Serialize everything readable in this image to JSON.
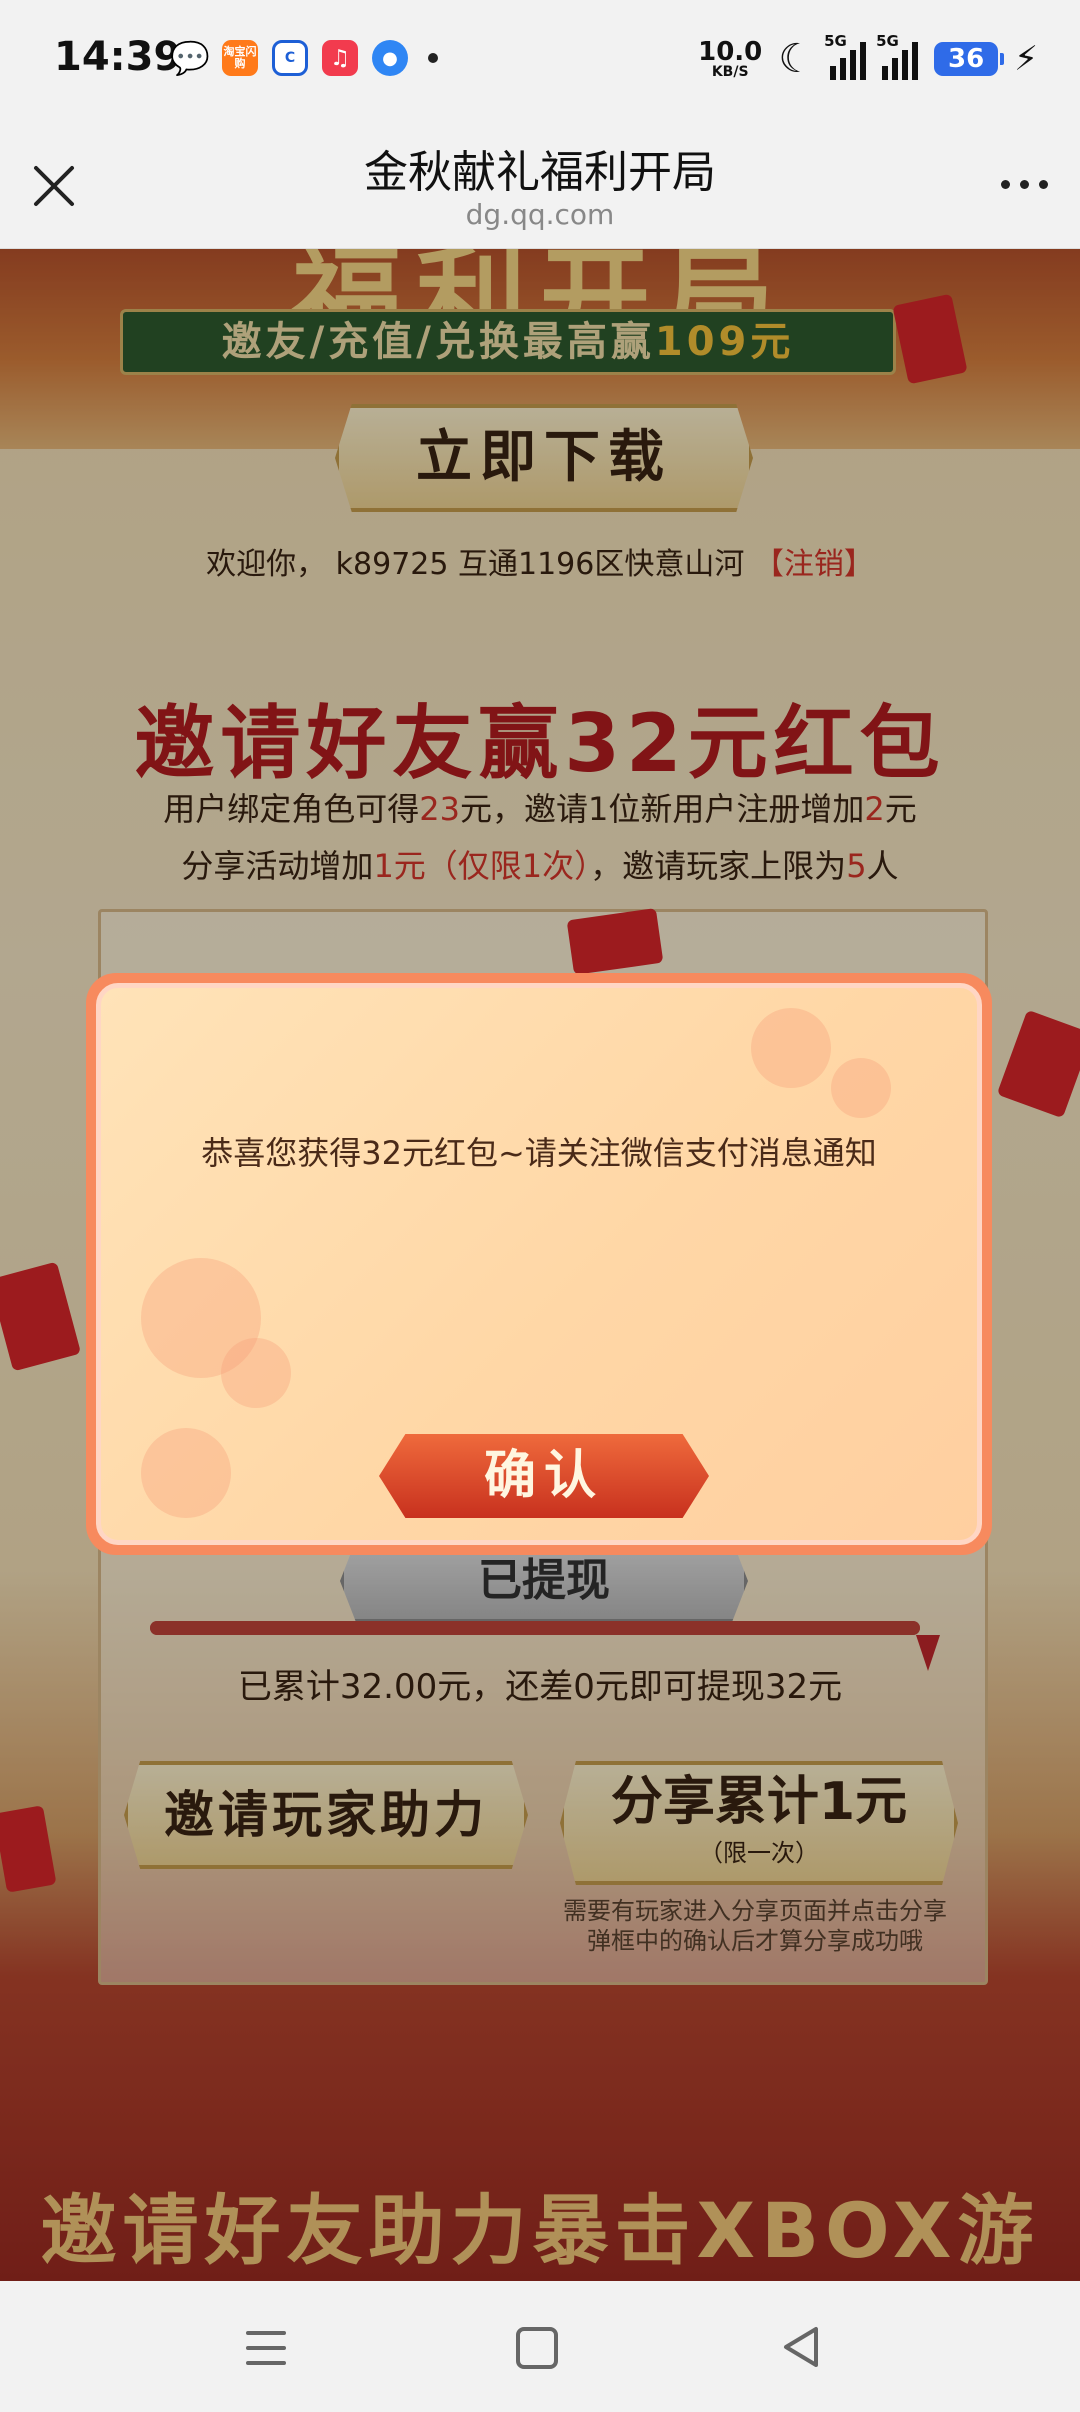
{
  "status_bar": {
    "time": "14:39",
    "apps": [
      "wechat-icon",
      "taobao-flash-icon",
      "cmb-icon",
      "music-icon",
      "browser-icon"
    ],
    "taobao_label": "淘宝闪购",
    "net_speed_value": "10.0",
    "net_speed_unit": "KB/S",
    "signal_1_tag": "5G",
    "signal_2_tag": "5G",
    "battery": "36"
  },
  "browser": {
    "title": "金秋献礼福利开局",
    "url": "dg.qq.com"
  },
  "page": {
    "hero_title": "福利开局",
    "hero_banner_text": "邀友/充值/兑换最高赢",
    "hero_banner_highlight": "109元",
    "download_button": "立即下载",
    "welcome_prefix": "欢迎你， k89725 互通1196区快意山河",
    "logout_link": "【注销】",
    "invite_title": "邀请好友赢32元红包",
    "rules_line1": {
      "a": "用户绑定角色可得",
      "b": "23",
      "c": "元，邀请1位新用户注册增加",
      "d": "2",
      "e": "元"
    },
    "rules_line2": {
      "a": "分享活动增加",
      "b": "1元（仅限1次）",
      "c": "，邀请玩家上限为",
      "d": "5",
      "e": "人"
    },
    "withdrawn_button": "已提现",
    "progress_fraction": 1.0,
    "accumulated_text": "已累计32.00元，还差0元即可提现32元",
    "assist_button": "邀请玩家助力",
    "share_button": "分享累计1元",
    "share_button_sub": "（限一次）",
    "share_note_line1": "需要有玩家进入分享页面并点击分享",
    "share_note_line2": "弹框中的确认后才算分享成功哦",
    "bottom_title": "邀请好友助力暴击XBOX游戏机"
  },
  "dialog": {
    "message": "恭喜您获得32元红包~请关注微信支付消息通知",
    "confirm_button": "确认"
  },
  "nav_bar": {
    "icons": [
      "menu-icon",
      "home-icon",
      "back-icon"
    ]
  }
}
